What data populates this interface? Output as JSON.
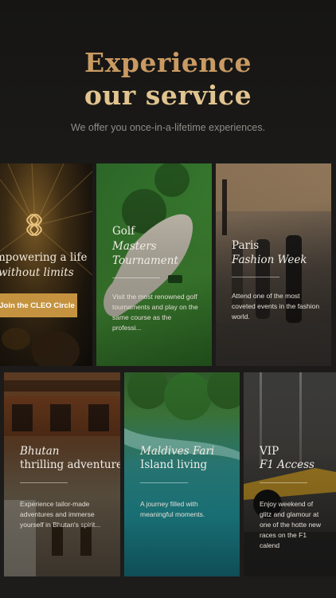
{
  "hero": {
    "title_line1": "Experience",
    "title_line2": "our service",
    "subtitle": "We offer you once-in-a-lifetime experiences."
  },
  "cleo_card": {
    "title_line1": "mpowering a life",
    "title_line2": "without limits",
    "button_label": "Join the CLEO Circle",
    "icon": "cleo-logo-icon"
  },
  "cards": {
    "golf": {
      "title_line1": "Golf",
      "title_line2": "Masters",
      "title_line3": "Tournament",
      "description": "Visit the most renowned golf tournaments and play on the same course as the professi..."
    },
    "paris": {
      "title_line1": "Paris",
      "title_line2": "Fashion Week",
      "description": "Attend one of the most coveted events in the fashion world."
    },
    "bhutan": {
      "title_line1": "Bhutan",
      "title_line2": "thrilling adventure",
      "description": "Experience tailor-made adventures and immerse yourself in Bhutan's spirit..."
    },
    "maldives": {
      "title_line1": "Maldives Fari",
      "title_line2": "Island living",
      "description": "A journey filled with meaningful moments."
    },
    "vip": {
      "title_line1": "VIP",
      "title_line2": "F1 Access",
      "description": "Enjoy weekend of glitz and glamour at one of the hotte new races on the F1 calend"
    }
  },
  "colors": {
    "accent_gold": "#c5933f",
    "title_gold": "#d6b37c",
    "background": "#1b1a18"
  }
}
